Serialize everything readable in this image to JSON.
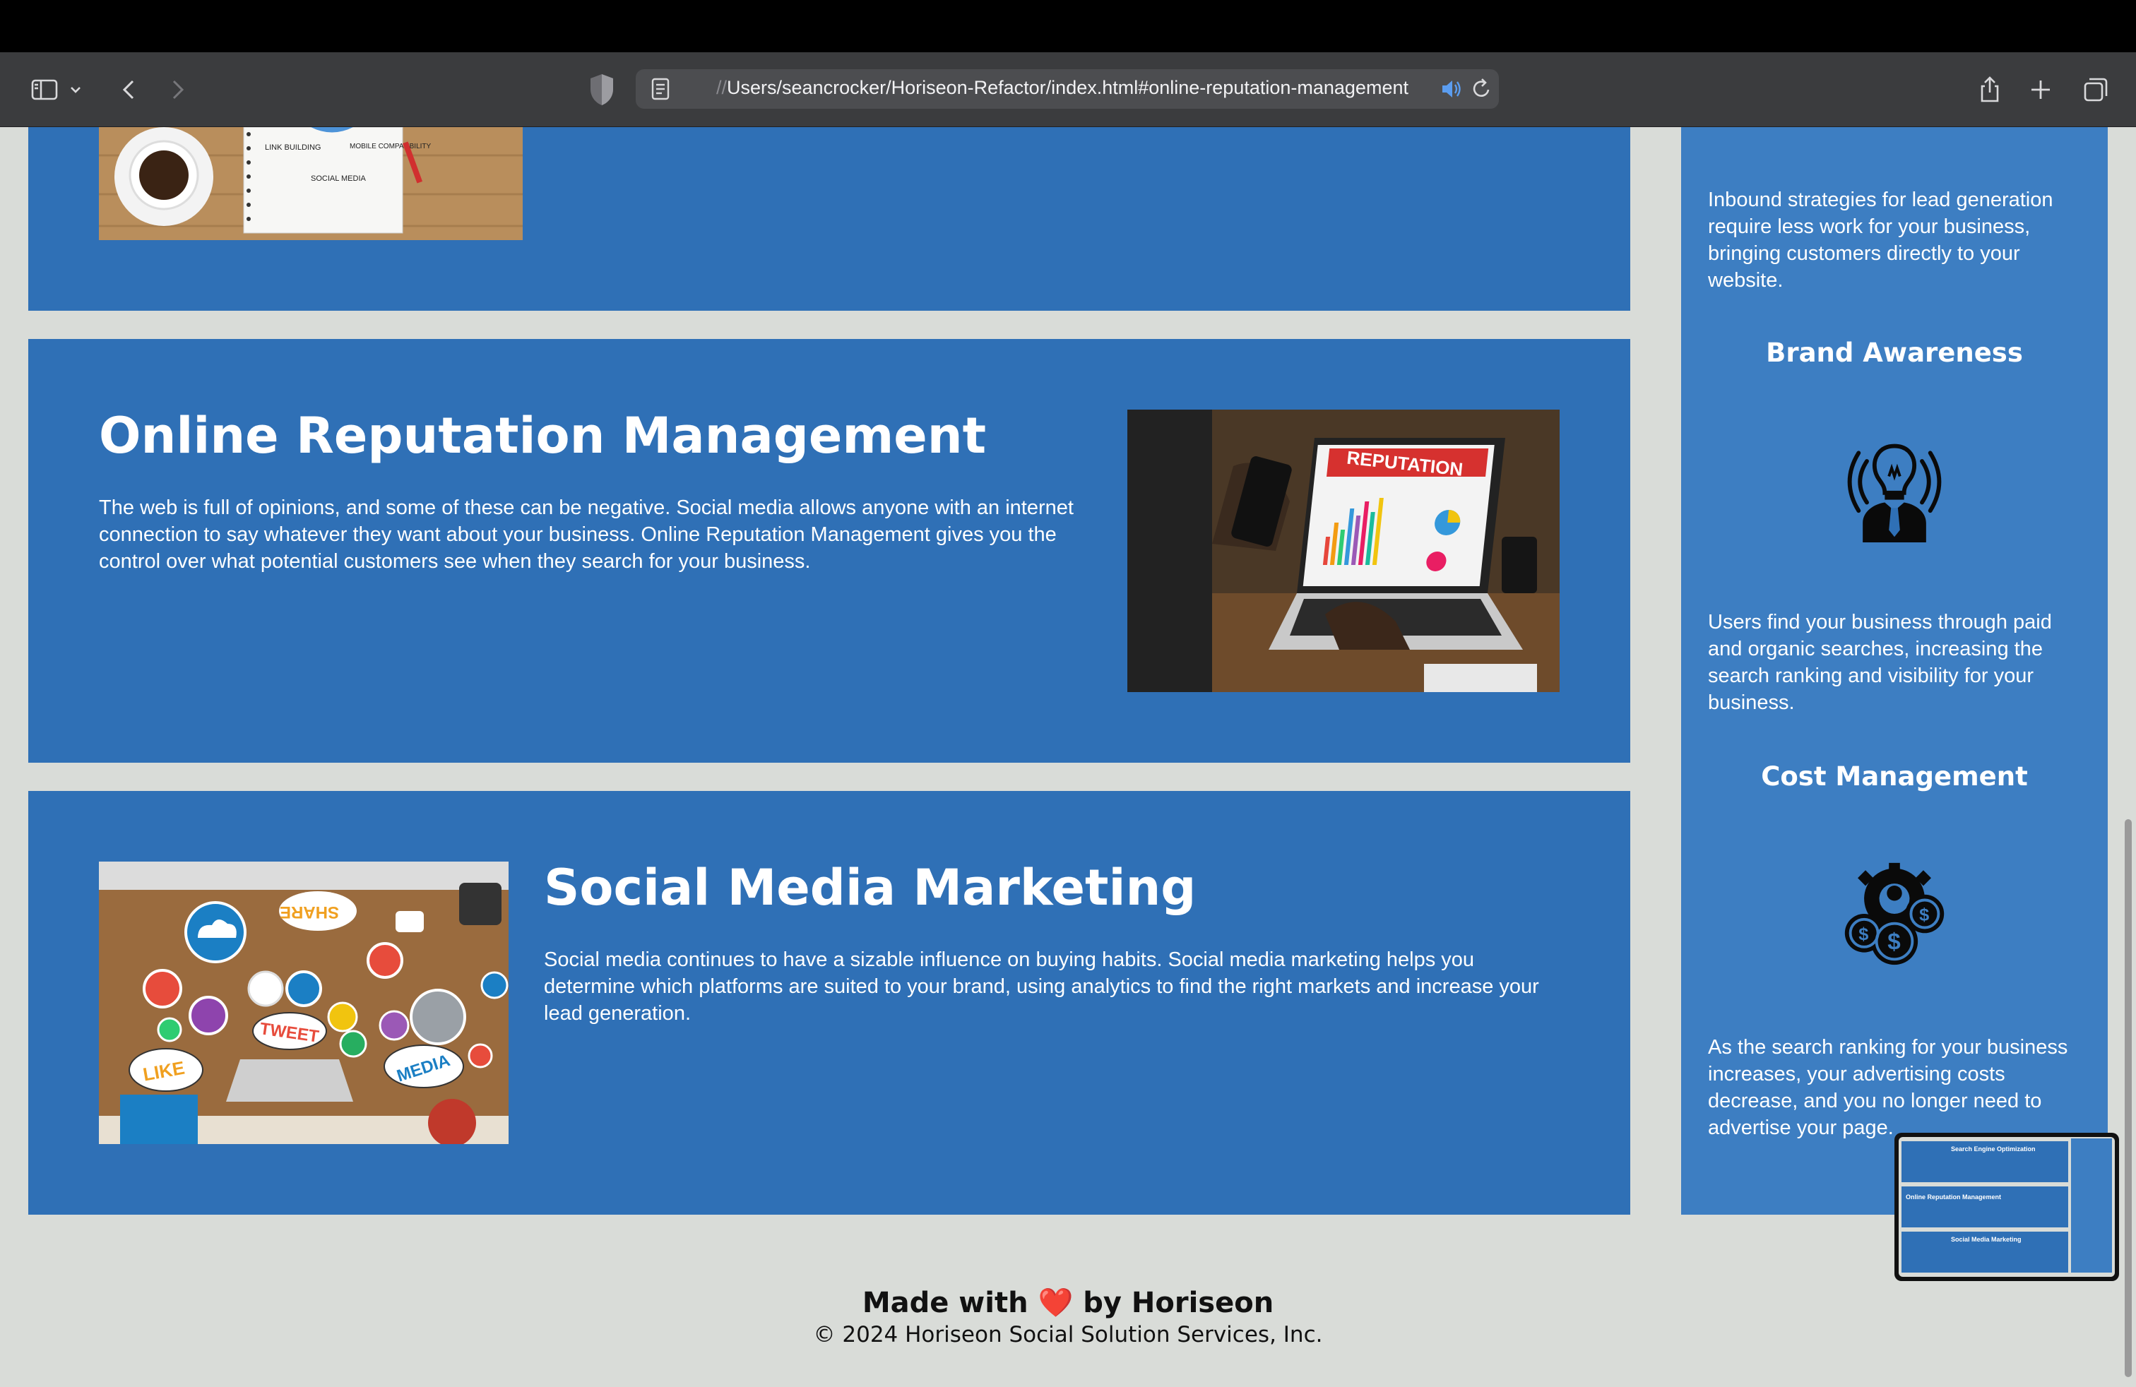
{
  "browser": {
    "url_scheme": "//",
    "url_path": "Users/seancrocker/Horiseon-Refactor/index.html#online-reputation-management"
  },
  "sections": {
    "reputation": {
      "title": "Online Reputation Management",
      "body": "The web is full of opinions, and some of these can be negative. Social media allows anyone with an internet connection to say whatever they want about your business. Online Reputation Management gives you the control over what potential customers see when they search for your business.",
      "image_label": "REPUTATION"
    },
    "social": {
      "title": "Social Media Marketing",
      "body": "Social media continues to have a sizable influence on buying habits. Social media marketing helps you determine which platforms are suited to your brand, using analytics to find the right markets and increase your lead generation.",
      "image_words": [
        "SHARE",
        "TWEET",
        "LIKE",
        "MEDIA"
      ]
    },
    "seo_image_words": [
      "LINK BUILDING",
      "MOBILE COMPATIBILITY",
      "SOCIAL MEDIA"
    ]
  },
  "sidebar": {
    "lead_text": "Inbound strategies for lead generation require less work for your business, bringing customers directly to your website.",
    "brand": {
      "title": "Brand Awareness",
      "icon": "lightbulb-person-icon",
      "text": "Users find your business through paid and organic searches, increasing the search ranking and visibility for your business."
    },
    "cost": {
      "title": "Cost Management",
      "icon": "gear-dollar-icon",
      "text": "As the search ranking for your business increases, your advertising costs decrease, and you no longer need to advertise your page."
    }
  },
  "footer": {
    "made_prefix": "Made with",
    "heart": "❤️",
    "made_suffix": "by Horiseon",
    "copyright": "© 2024 Horiseon Social Solution Services, Inc."
  },
  "thumbnail": {
    "items": [
      "Search Engine Optimization",
      "Online Reputation Management",
      "Social Media Marketing"
    ]
  },
  "colors": {
    "panel": "#2f70b6",
    "sidebar": "#3d7ec2",
    "page_bg": "#d9dcd8"
  }
}
